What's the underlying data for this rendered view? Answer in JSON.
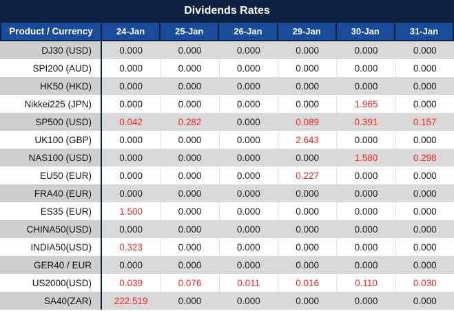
{
  "title": "Dividends Rates",
  "colors": {
    "title_bar": "#0d2240",
    "header_blue": "#1a4c9c",
    "grid_navy": "#0d2240",
    "row_gray_product": "#cfcfcf",
    "row_gray_value": "#d9d9d9",
    "row_white": "#ffffff",
    "header_text": "#ffffff",
    "value_black": "#1a1a1a",
    "value_red": "#f42525"
  },
  "table": {
    "product_header": "Product / Currency",
    "date_headers": [
      "24-Jan",
      "25-Jan",
      "26-Jan",
      "29-Jan",
      "30-Jan",
      "31-Jan"
    ],
    "rows": [
      {
        "product": "DJ30 (USD)",
        "values": [
          "0.000",
          "0.000",
          "0.000",
          "0.000",
          "0.000",
          "0.000"
        ],
        "red": [
          false,
          false,
          false,
          false,
          false,
          false
        ]
      },
      {
        "product": "SPI200 (AUD)",
        "values": [
          "0.000",
          "0.000",
          "0.000",
          "0.000",
          "0.000",
          "0.000"
        ],
        "red": [
          false,
          false,
          false,
          false,
          false,
          false
        ]
      },
      {
        "product": "HK50 (HKD)",
        "values": [
          "0.000",
          "0.000",
          "0.000",
          "0.000",
          "0.000",
          "0.000"
        ],
        "red": [
          false,
          false,
          false,
          false,
          false,
          false
        ]
      },
      {
        "product": "Nikkei225 (JPN)",
        "values": [
          "0.000",
          "0.000",
          "0.000",
          "0.000",
          "1.965",
          "0.000"
        ],
        "red": [
          false,
          false,
          false,
          false,
          true,
          false
        ]
      },
      {
        "product": "SP500 (USD)",
        "values": [
          "0.042",
          "0.282",
          "0.000",
          "0.089",
          "0.391",
          "0.157"
        ],
        "red": [
          true,
          true,
          false,
          true,
          true,
          true
        ]
      },
      {
        "product": "UK100 (GBP)",
        "values": [
          "0.000",
          "0.000",
          "0.000",
          "2.643",
          "0.000",
          "0.000"
        ],
        "red": [
          false,
          false,
          false,
          true,
          false,
          false
        ]
      },
      {
        "product": "NAS100 (USD)",
        "values": [
          "0.000",
          "0.000",
          "0.000",
          "0.000",
          "1.580",
          "0.298"
        ],
        "red": [
          false,
          false,
          false,
          false,
          true,
          true
        ]
      },
      {
        "product": "EU50 (EUR)",
        "values": [
          "0.000",
          "0.000",
          "0.000",
          "0.227",
          "0.000",
          "0.000"
        ],
        "red": [
          false,
          false,
          false,
          true,
          false,
          false
        ]
      },
      {
        "product": "FRA40 (EUR)",
        "values": [
          "0.000",
          "0.000",
          "0.000",
          "0.000",
          "0.000",
          "0.000"
        ],
        "red": [
          false,
          false,
          false,
          false,
          false,
          false
        ]
      },
      {
        "product": "ES35 (EUR)",
        "values": [
          "1.500",
          "0.000",
          "0.000",
          "0.000",
          "0.000",
          "0.000"
        ],
        "red": [
          true,
          false,
          false,
          false,
          false,
          false
        ]
      },
      {
        "product": "CHINA50(USD)",
        "values": [
          "0.000",
          "0.000",
          "0.000",
          "0.000",
          "0.000",
          "0.000"
        ],
        "red": [
          false,
          false,
          false,
          false,
          false,
          false
        ]
      },
      {
        "product": "INDIA50(USD)",
        "values": [
          "0.323",
          "0.000",
          "0.000",
          "0.000",
          "0.000",
          "0.000"
        ],
        "red": [
          true,
          false,
          false,
          false,
          false,
          false
        ]
      },
      {
        "product": "GER40 / EUR",
        "values": [
          "0.000",
          "0.000",
          "0.000",
          "0.000",
          "0.000",
          "0.000"
        ],
        "red": [
          false,
          false,
          false,
          false,
          false,
          false
        ]
      },
      {
        "product": "US2000(USD)",
        "values": [
          "0.039",
          "0.076",
          "0.011",
          "0.016",
          "0.110",
          "0.030"
        ],
        "red": [
          true,
          true,
          true,
          true,
          true,
          true
        ]
      },
      {
        "product": "SA40(ZAR)",
        "values": [
          "222.519",
          "0.000",
          "0.000",
          "0.000",
          "0.000",
          "0.000"
        ],
        "red": [
          true,
          false,
          false,
          false,
          false,
          false
        ]
      }
    ]
  }
}
